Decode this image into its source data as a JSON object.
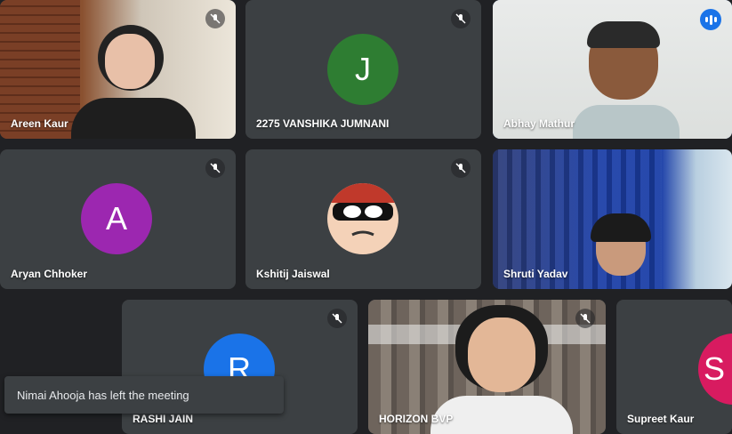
{
  "participants": [
    {
      "name": "Areen Kaur",
      "video": true,
      "muted": true
    },
    {
      "name": "2275 VANSHIKA JUMNANI",
      "initial": "J",
      "avatar_color": "#2e7d32",
      "muted": true
    },
    {
      "name": "Abhay Mathur",
      "video": true,
      "speaking": true
    },
    {
      "name": "Aryan Chhoker",
      "initial": "A",
      "avatar_color": "#9c27b0",
      "muted": true
    },
    {
      "name": "Kshitij Jaiswal",
      "avatar_type": "cartoon",
      "muted": true
    },
    {
      "name": "Shruti Yadav",
      "video": true
    },
    {
      "name": "RASHI JAIN",
      "initial": "R",
      "avatar_color": "#1a73e8",
      "muted": true
    },
    {
      "name": "HORIZON BVP",
      "video": true,
      "muted": true
    },
    {
      "name": "Supreet Kaur",
      "initial": "S",
      "avatar_color": "#d81b60"
    }
  ],
  "notification": {
    "text": "Nimai Ahooja has left the meeting"
  },
  "colors": {
    "background": "#202124",
    "tile": "#3c4043",
    "active_border": "#8ab4f8",
    "speaking": "#1a73e8"
  }
}
